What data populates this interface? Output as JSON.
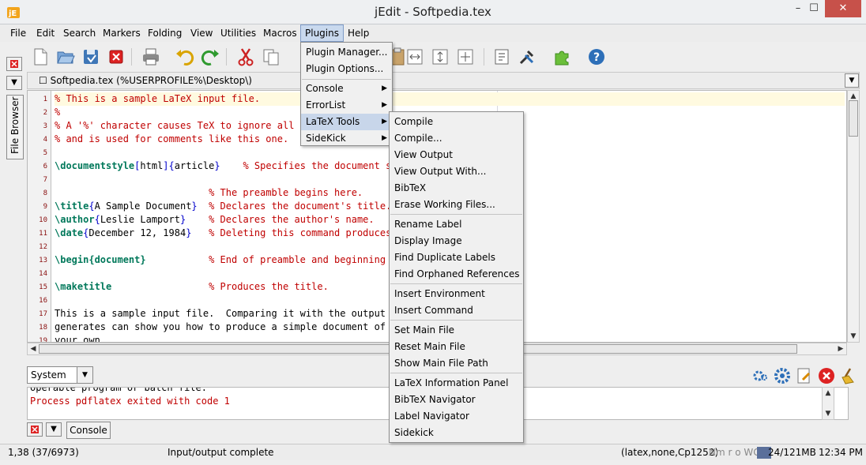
{
  "window": {
    "title": "jEdit - Softpedia.tex",
    "min": "–",
    "max": "☐",
    "close": "✕"
  },
  "menubar": [
    "File",
    "Edit",
    "Search",
    "Markers",
    "Folding",
    "View",
    "Utilities",
    "Macros",
    "Plugins",
    "Help"
  ],
  "buffer": {
    "label": "Softpedia.tex (%USERPROFILE%\\Desktop\\)"
  },
  "dock": {
    "file_browser": "File Browser",
    "console_tab": "Console"
  },
  "editor_lines": [
    {
      "n": "1",
      "segs": [
        [
          "c-comment",
          "% This is a sample LaTeX input file."
        ]
      ]
    },
    {
      "n": "2",
      "segs": [
        [
          "c-comment",
          "%"
        ]
      ]
    },
    {
      "n": "3",
      "segs": [
        [
          "c-comment",
          "% A '%' character causes TeX to ignore all re"
        ]
      ]
    },
    {
      "n": "4",
      "segs": [
        [
          "c-comment",
          "% and is used for comments like this one."
        ]
      ]
    },
    {
      "n": "5",
      "segs": []
    },
    {
      "n": "6",
      "segs": [
        [
          "c-cmd",
          "\\documentstyle"
        ],
        [
          "c-brace",
          "["
        ],
        [
          "c-text",
          "html"
        ],
        [
          "c-brace",
          "]{"
        ],
        [
          "c-text",
          "article"
        ],
        [
          "c-brace",
          "}"
        ],
        [
          "c-text",
          "    "
        ],
        [
          "c-comment",
          "% Specifies the document sty"
        ]
      ]
    },
    {
      "n": "7",
      "segs": []
    },
    {
      "n": "8",
      "segs": [
        [
          "c-text",
          "                           "
        ],
        [
          "c-comment",
          "% The preamble begins here."
        ]
      ]
    },
    {
      "n": "9",
      "segs": [
        [
          "c-cmd",
          "\\title"
        ],
        [
          "c-brace",
          "{"
        ],
        [
          "c-text",
          "A Sample Document"
        ],
        [
          "c-brace",
          "}"
        ],
        [
          "c-text",
          "  "
        ],
        [
          "c-comment",
          "% Declares the document's title."
        ]
      ]
    },
    {
      "n": "10",
      "segs": [
        [
          "c-cmd",
          "\\author"
        ],
        [
          "c-brace",
          "{"
        ],
        [
          "c-text",
          "Leslie Lamport"
        ],
        [
          "c-brace",
          "}"
        ],
        [
          "c-text",
          "    "
        ],
        [
          "c-comment",
          "% Declares the author's name."
        ]
      ]
    },
    {
      "n": "11",
      "segs": [
        [
          "c-cmd",
          "\\date"
        ],
        [
          "c-brace",
          "{"
        ],
        [
          "c-text",
          "December 12, 1984"
        ],
        [
          "c-brace",
          "}"
        ],
        [
          "c-text",
          "   "
        ],
        [
          "c-comment",
          "% Deleting this command produces t"
        ]
      ]
    },
    {
      "n": "12",
      "segs": []
    },
    {
      "n": "13",
      "segs": [
        [
          "c-cmd",
          "\\begin{document}"
        ],
        [
          "c-text",
          "           "
        ],
        [
          "c-comment",
          "% End of preamble and beginning of"
        ]
      ]
    },
    {
      "n": "14",
      "segs": []
    },
    {
      "n": "15",
      "segs": [
        [
          "c-cmd",
          "\\maketitle"
        ],
        [
          "c-text",
          "                 "
        ],
        [
          "c-comment",
          "% Produces the title."
        ]
      ]
    },
    {
      "n": "16",
      "segs": []
    },
    {
      "n": "17",
      "segs": [
        [
          "c-text",
          "This is a sample input file.  Comparing it with the output it"
        ]
      ]
    },
    {
      "n": "18",
      "segs": [
        [
          "c-text",
          "generates can show you how to produce a simple document of"
        ]
      ]
    },
    {
      "n": "19",
      "segs": [
        [
          "c-text",
          "your own."
        ]
      ]
    }
  ],
  "console": {
    "selector": "System",
    "lines": [
      {
        "cls": "c-text",
        "text": "operable program or batch file."
      },
      {
        "cls": "c-comment",
        "text": "Process pdflatex exited with code 1"
      }
    ]
  },
  "statusbar": {
    "position": "1,38 (37/6973)",
    "message": "Input/output complete",
    "mode": "(latex,none,Cp1252)",
    "flags": "Nm r o WG",
    "memory": "24/121MB",
    "time": "12:34 PM"
  },
  "plugins_menu": [
    "Plugin Manager...",
    "Plugin Options...",
    "Console",
    "ErrorList",
    "LaTeX Tools",
    "SideKick"
  ],
  "latex_menu": [
    [
      "Compile",
      "Compile...",
      "View Output",
      "View Output With...",
      "BibTeX",
      "Erase Working Files..."
    ],
    [
      "Rename Label",
      "Display Image",
      "Find Duplicate Labels",
      "Find Orphaned References"
    ],
    [
      "Insert Environment",
      "Insert Command"
    ],
    [
      "Set Main File",
      "Reset Main File",
      "Show Main File Path"
    ],
    [
      "LaTeX Information Panel",
      "BibTeX Navigator",
      "Label Navigator",
      "Sidekick"
    ]
  ],
  "icons": {
    "toolbar": [
      "new-file-icon",
      "open-file-icon",
      "save-icon",
      "close-buffer-icon",
      "print-icon",
      "undo-icon",
      "redo-icon",
      "cut-icon",
      "copy-icon",
      "paste-icon",
      "search-icon",
      "split-horizontal-icon",
      "split-vertical-icon",
      "unsplit-icon",
      "buffer-options-icon",
      "global-options-icon",
      "plugin-manager-icon",
      "help-icon"
    ],
    "console": [
      "run-icon",
      "settings-gear-icon",
      "edit-icon",
      "stop-icon",
      "clear-icon"
    ]
  },
  "colors": {
    "comment": "#c00000",
    "command": "#00785a",
    "brace": "#0000cc",
    "menu_highlight": "#c8d6ea",
    "close_button": "#c7514a"
  }
}
